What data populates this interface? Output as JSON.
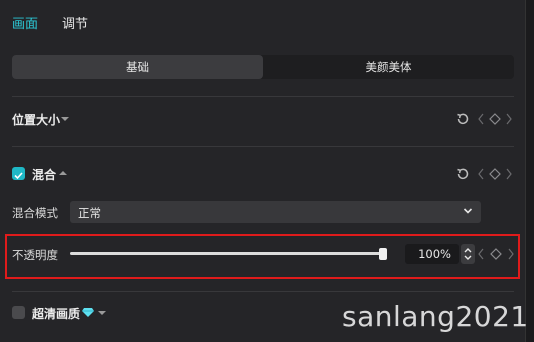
{
  "tabs": [
    {
      "label": "画面"
    },
    {
      "label": "调节"
    }
  ],
  "segment": {
    "options": [
      "基础",
      "美颜美体"
    ]
  },
  "sections": {
    "position": {
      "title": "位置大小"
    },
    "blend": {
      "title": "混合",
      "checked": true
    },
    "superres": {
      "title": "超清画质",
      "checked": false
    }
  },
  "blend_mode": {
    "label": "混合模式",
    "value": "正常"
  },
  "opacity": {
    "label": "不透明度",
    "value": "100%",
    "level": 1.0
  },
  "watermark": "sanlang2021",
  "colors": {
    "accent": "#2bc8d6",
    "checkbox_on": "#1fb8c6",
    "highlight": "#e01b1b",
    "gem": "#5ee0f0"
  }
}
